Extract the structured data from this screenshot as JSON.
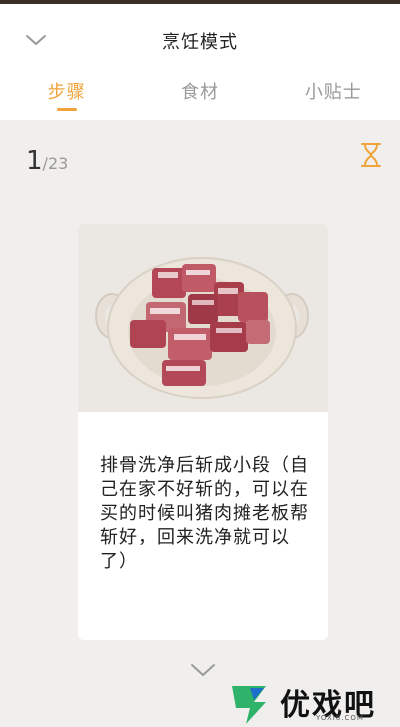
{
  "header": {
    "title": "烹饪模式",
    "collapse_icon": "chevron-down-icon"
  },
  "tabs": [
    {
      "label": "步骤",
      "active": true
    },
    {
      "label": "食材",
      "active": false
    },
    {
      "label": "小贴士",
      "active": false
    }
  ],
  "step": {
    "current": "1",
    "total": "/23",
    "timer_icon": "hourglass-icon",
    "image": "plate-of-pork-ribs",
    "text": "排骨洗净后斩成小段（自己在家不好斩的，可以在买的时候叫猪肉摊老板帮斩好，回来洗净就可以了）"
  },
  "footer": {
    "next_icon": "chevron-down-icon"
  },
  "watermark": {
    "text": "优戏吧",
    "sub": "YOXI8.COM"
  },
  "colors": {
    "accent": "#f0a33a",
    "background": "#f0efed",
    "card": "#ffffff"
  }
}
